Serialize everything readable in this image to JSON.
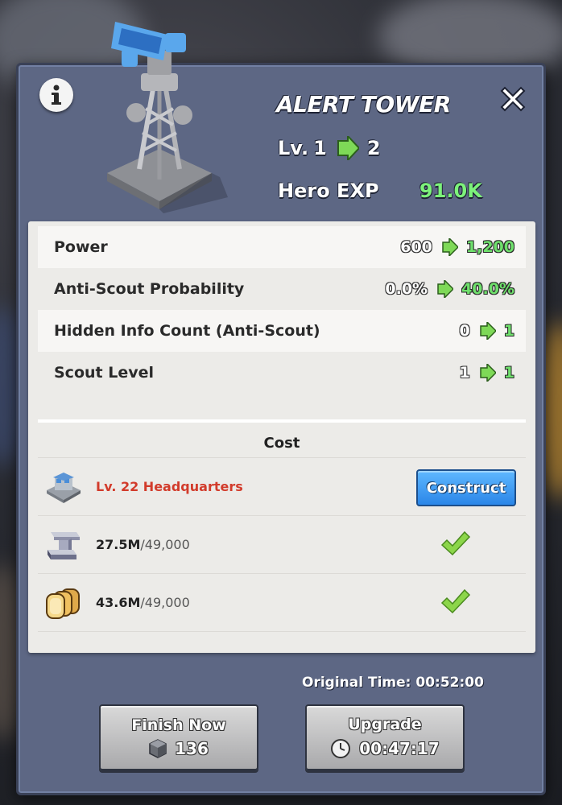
{
  "building": {
    "title": "ALERT TOWER",
    "level_prefix": "Lv.",
    "level_current": "1",
    "level_next": "2",
    "hero_exp_label": "Hero EXP",
    "hero_exp_value": "91.0K"
  },
  "stats": [
    {
      "label": "Power",
      "old": "600",
      "new": "1,200"
    },
    {
      "label": "Anti-Scout Probability",
      "old": "0.0%",
      "new": "40.0%"
    },
    {
      "label": "Hidden Info Count (Anti-Scout)",
      "old": "0",
      "new": "1"
    },
    {
      "label": "Scout Level",
      "old": "1",
      "new": "1"
    }
  ],
  "cost": {
    "heading": "Cost",
    "requirement": {
      "label": "Lv. 22 Headquarters",
      "button_label": "Construct"
    },
    "resources": [
      {
        "icon": "iron-icon",
        "have": "27.5M",
        "need": "/49,000",
        "met": true
      },
      {
        "icon": "bread-icon",
        "have": "43.6M",
        "need": "/49,000",
        "met": true
      }
    ]
  },
  "timing": {
    "original_time": "Original Time: 00:52:00"
  },
  "actions": {
    "finish_now_label": "Finish Now",
    "finish_now_cost": "136",
    "upgrade_label": "Upgrade",
    "upgrade_time": "00:47:17"
  },
  "colors": {
    "panel": "#5d6784",
    "new_value_green": "#6fe06c",
    "requirement_red": "#d23b2b",
    "construct_blue": "#2b86e8"
  }
}
